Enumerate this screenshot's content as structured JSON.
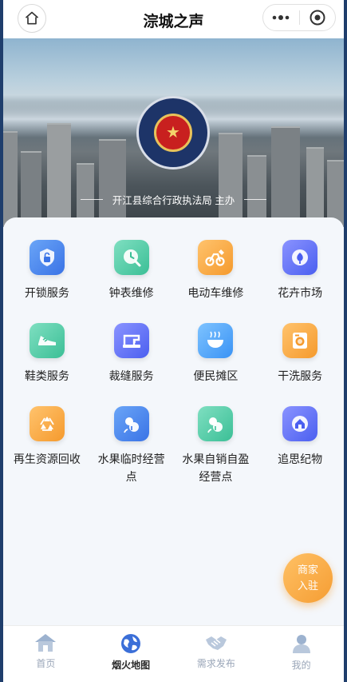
{
  "header": {
    "title": "淙城之声",
    "home_icon": "home-icon",
    "more_icon": "more-dots-icon",
    "close_icon": "target-circle-icon"
  },
  "banner": {
    "sponsor_text": "开江县综合行政执法局 主办",
    "emblem_icon": "administrative-law-enforcement-emblem"
  },
  "services": [
    {
      "label": "开锁服务",
      "icon": "unlock-icon",
      "color": "#3a73e6"
    },
    {
      "label": "钟表维修",
      "icon": "clock-repair-icon",
      "color": "#3bbf96"
    },
    {
      "label": "电动车维修",
      "icon": "ebike-repair-icon",
      "color": "#f59a2d"
    },
    {
      "label": "花卉市场",
      "icon": "flower-icon",
      "color": "#4b5ff0"
    },
    {
      "label": "鞋类服务",
      "icon": "shoe-icon",
      "color": "#3bbf96"
    },
    {
      "label": "裁缝服务",
      "icon": "sewing-machine-icon",
      "color": "#4b5ff0"
    },
    {
      "label": "便民摊区",
      "icon": "stall-bowl-icon",
      "color": "#3a93f5"
    },
    {
      "label": "干洗服务",
      "icon": "washing-machine-icon",
      "color": "#f59a2d"
    },
    {
      "label": "再生资源回收",
      "icon": "recycle-icon",
      "color": "#f59a2d"
    },
    {
      "label": "水果临时经营点",
      "icon": "fruit-temp-icon",
      "color": "#3a73e6"
    },
    {
      "label": "水果自销自盈经营点",
      "icon": "fruit-self-icon",
      "color": "#3bbf96"
    },
    {
      "label": "追思纪物",
      "icon": "memorial-house-icon",
      "color": "#4b5ff0"
    }
  ],
  "merchant_button": {
    "line1": "商家",
    "line2": "入驻"
  },
  "tabbar": [
    {
      "label": "首页",
      "icon": "home-tab-icon",
      "active": false
    },
    {
      "label": "烟火地图",
      "icon": "map-globe-icon",
      "active": true
    },
    {
      "label": "需求发布",
      "icon": "handshake-icon",
      "active": false
    },
    {
      "label": "我的",
      "icon": "user-icon",
      "active": false
    }
  ]
}
